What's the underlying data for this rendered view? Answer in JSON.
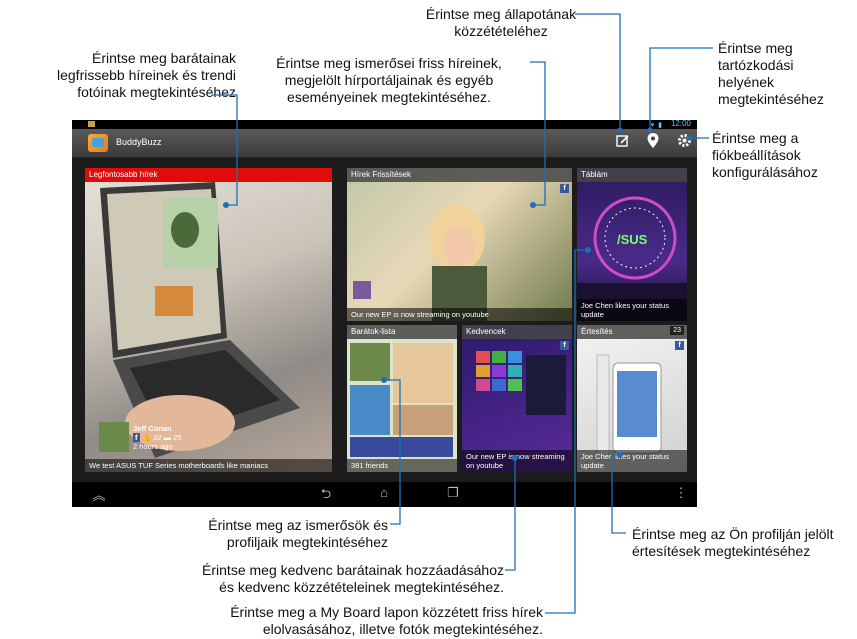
{
  "callouts": {
    "friends_news": "Érintse meg barátainak\nlegfrissebb híreinek és trendi\nfotóinak megtekintéséhez",
    "acquaintance_news": "Érintse meg ismerősei friss híreinek,\nmegjelölt hírportáljainak és egyéb\neseményeinek megtekintéséhez.",
    "status": "Érintse meg állapotának\nközzétételéhez",
    "location": "Érintse meg\ntartózkodási\nhelyének\nmegtekintéséhez",
    "settings": "Érintse meg a\nfiókbeállítások\nkonfigurálásához",
    "friends_list": "Érintse meg az ismerősök és\nprofiljaik megtekintéséhez",
    "favorites": "Érintse meg kedvenc barátainak hozzáadásához\nés kedvenc közzétételeinek megtekintéséhez.",
    "my_board": "Érintse meg a My Board lapon közzétett friss hírek\nelolvasásához, illetve fotók megtekintéséhez.",
    "notifications": "Érintse meg az Ön profilján jelölt\nértesítések megtekintéséhez"
  },
  "statusbar": {
    "clock": "12:00"
  },
  "app": {
    "title": "BuddyBuzz"
  },
  "tiles": {
    "top_news": {
      "title": "Legfontosabb hírek",
      "author": "Jeff Conan",
      "likes": "32",
      "comments": "25",
      "time": "2 hours ago",
      "caption": "We test ASUS TUF Series motherboards like maniacs"
    },
    "news_feed": {
      "title": "Hírek Frissítések",
      "caption": "Our new EP is now streaming on youtube"
    },
    "my_board": {
      "title": "Táblám",
      "caption": "Joe Chen likes your status update"
    },
    "friends": {
      "title": "Barátok-lista",
      "caption": "381 friends"
    },
    "favorites": {
      "title": "Kedvencek",
      "caption": "Our new EP is now streaming on youtube"
    },
    "notifications": {
      "title": "Értesítés",
      "count": "23",
      "caption": "Joe Chen likes your status update"
    }
  },
  "colors": {
    "accent_red": "#e10b0b",
    "facebook": "#3b5998",
    "line": "#1f6fb2"
  }
}
